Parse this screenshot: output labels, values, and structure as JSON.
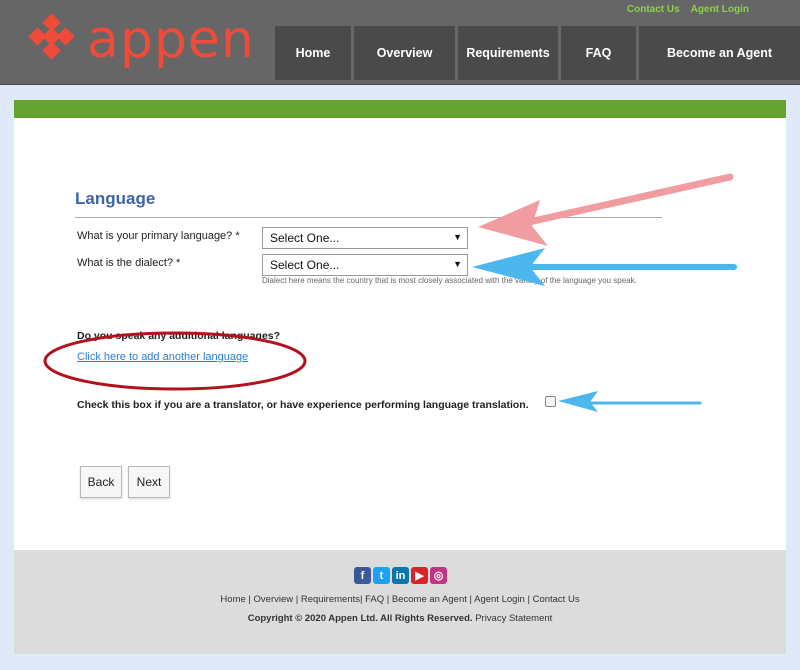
{
  "header": {
    "logo_text": "appen",
    "top_links": [
      "Contact Us",
      "Agent Login"
    ],
    "nav": [
      "Home",
      "Overview",
      "Requirements",
      "FAQ",
      "Become an Agent"
    ]
  },
  "form": {
    "section_title": "Language",
    "primary_language_label": "What is your primary language? *",
    "primary_language_value": "Select One...",
    "dialect_label": "What is the dialect? *",
    "dialect_value": "Select One...",
    "dialect_hint": "Dialect here means the country that is most closely associated with the variety of the language you speak.",
    "additional_languages_label": "Do you speak any additional languages?",
    "add_language_link": "Click here to add another language",
    "translator_label": "Check this box if you are a translator, or have experience performing language translation.",
    "translator_checked": false,
    "back_label": "Back",
    "next_label": "Next"
  },
  "footer": {
    "social_icons": [
      "facebook-icon",
      "twitter-icon",
      "linkedin-icon",
      "youtube-icon",
      "instagram-icon"
    ],
    "links": [
      "Home",
      "Overview",
      "Requirements",
      "FAQ",
      "Become an Agent",
      "Agent Login",
      "Contact Us"
    ],
    "copyright": "Copyright © 2020 Appen Ltd. All Rights Reserved.",
    "privacy": "Privacy Statement"
  },
  "colors": {
    "header_bg": "#666666",
    "nav_bg": "#4a4a4a",
    "green_bar": "#66a22e",
    "accent_orange": "#ee4b3a",
    "title_blue": "#3d64a8",
    "link_blue": "#2b7ed1",
    "annotation_pink": "#f19ca0",
    "annotation_blue": "#4bb7ee",
    "annotation_red": "#b3121d"
  }
}
